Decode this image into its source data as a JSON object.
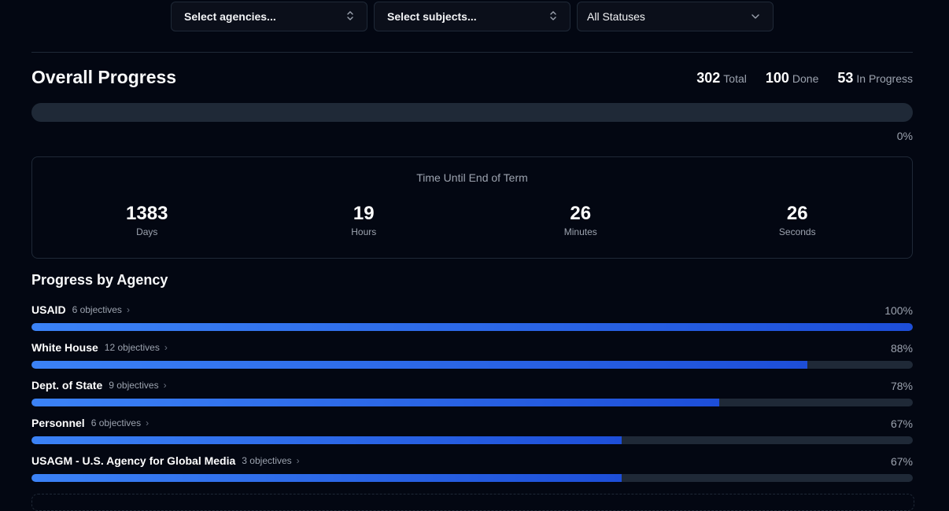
{
  "filters": {
    "agencies_label": "Select agencies...",
    "subjects_label": "Select subjects...",
    "status_label": "All Statuses"
  },
  "overall": {
    "title": "Overall Progress",
    "total_value": "302",
    "total_label": "Total",
    "done_value": "100",
    "done_label": "Done",
    "in_progress_value": "53",
    "in_progress_label": "In Progress",
    "progress_percent": 0,
    "progress_label": "0%"
  },
  "countdown": {
    "title": "Time Until End of Term",
    "units": [
      {
        "value": "1383",
        "label": "Days"
      },
      {
        "value": "19",
        "label": "Hours"
      },
      {
        "value": "26",
        "label": "Minutes"
      },
      {
        "value": "26",
        "label": "Seconds"
      }
    ]
  },
  "agencies": {
    "title": "Progress by Agency",
    "items": [
      {
        "name": "USAID",
        "objectives": "6 objectives",
        "percent": 100,
        "percent_label": "100%"
      },
      {
        "name": "White House",
        "objectives": "12 objectives",
        "percent": 88,
        "percent_label": "88%"
      },
      {
        "name": "Dept. of State",
        "objectives": "9 objectives",
        "percent": 78,
        "percent_label": "78%"
      },
      {
        "name": "Personnel",
        "objectives": "6 objectives",
        "percent": 67,
        "percent_label": "67%"
      },
      {
        "name": "USAGM - U.S. Agency for Global Media",
        "objectives": "3 objectives",
        "percent": 67,
        "percent_label": "67%"
      }
    ]
  },
  "colors": {
    "background": "#030712",
    "accent": "#3b82f6",
    "accent_dark": "#1d4ed8",
    "track": "#1f2937"
  },
  "icons": {
    "select_multi": "chevron-up-down-icon",
    "select_single": "chevron-down-icon",
    "agency_row": "chevron-right-icon"
  }
}
